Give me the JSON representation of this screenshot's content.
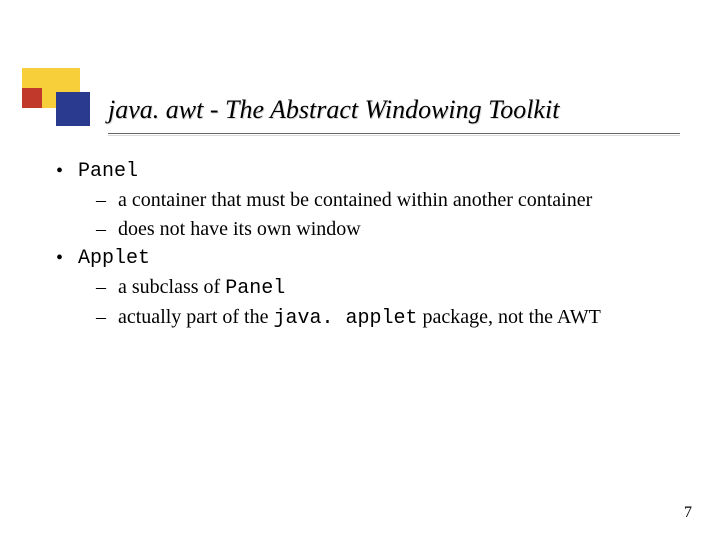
{
  "title": "java. awt - The Abstract Windowing Toolkit",
  "bullets": {
    "item1_label": "Panel",
    "item1_sub1": "a container that must be contained within another container",
    "item1_sub2": "does not have its own window",
    "item2_label": "Applet",
    "item2_sub1_prefix": "a subclass of ",
    "item2_sub1_code": "Panel",
    "item2_sub2_prefix": "actually part of the ",
    "item2_sub2_code": "java. applet",
    "item2_sub2_suffix": " package, not the AWT"
  },
  "glyphs": {
    "bullet": "•",
    "dash": "–"
  },
  "page_number": "7"
}
